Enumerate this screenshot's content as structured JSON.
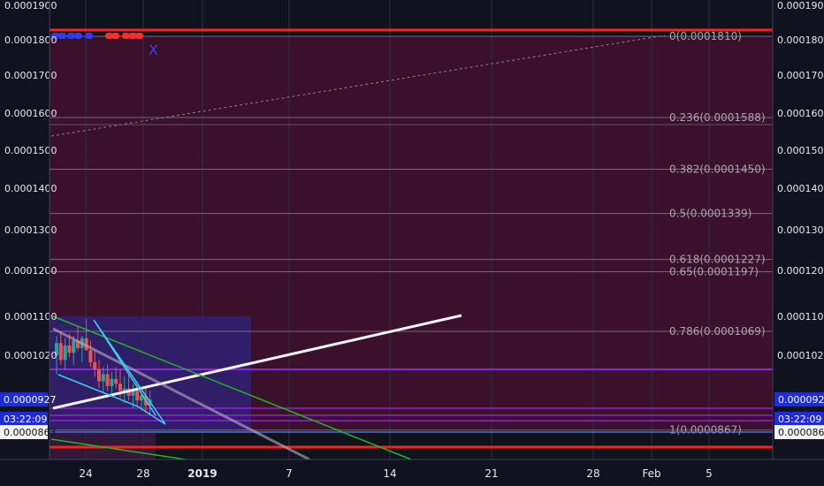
{
  "chart_data": {
    "type": "candlestick",
    "price_axis_labels": [
      "0.0001900",
      "0.0001800",
      "0.0001700",
      "0.0001600",
      "0.0001500",
      "0.0001400",
      "0.0001300",
      "0.0001200",
      "0.0001100",
      "0.0001020"
    ],
    "ylim": [
      8.4e-05,
      0.00019
    ],
    "time_axis_labels": [
      "24",
      "28",
      "2019",
      "7",
      "14",
      "21",
      "28",
      "Feb",
      "5"
    ],
    "fib_levels": [
      {
        "ratio": "0",
        "price": 0.000181,
        "label": "0(0.0001810)"
      },
      {
        "ratio": "0.236",
        "price": 0.0001588,
        "label": "0.236(0.0001588)"
      },
      {
        "ratio": "0.382",
        "price": 0.000145,
        "label": "0.382(0.0001450)"
      },
      {
        "ratio": "0.5",
        "price": 0.0001339,
        "label": "0.5(0.0001339)"
      },
      {
        "ratio": "0.618",
        "price": 0.0001227,
        "label": "0.618(0.0001227)"
      },
      {
        "ratio": "0.65",
        "price": 0.0001197,
        "label": "0.65(0.0001197)"
      },
      {
        "ratio": "0.786",
        "price": 0.0001069,
        "label": "0.786(0.0001069)"
      },
      {
        "ratio": "1",
        "price": 8.67e-05,
        "label": "1(0.0000867)"
      }
    ],
    "current_price_tag": "0.0000927",
    "countdown_tag": "03:22:09",
    "crosshair_price_tag": "0.0000863",
    "marker_text": "X",
    "colors": {
      "fib_zone": "#4a1030",
      "resistance": "#ff1f1f",
      "purple_level": "#a020f0",
      "trend_white": "#f5f5f5",
      "trend_green": "#1fb81f",
      "trend_cyan": "#3ad0f0",
      "candle_up": "#26a69a",
      "candle_down": "#ef5350",
      "tag_blue": "#1e2bd8"
    },
    "candles": [
      {
        "o": 0.000102,
        "h": 0.000106,
        "l": 9.8e-05,
        "c": 0.0001045
      },
      {
        "o": 0.0001045,
        "h": 0.000107,
        "l": 0.0001,
        "c": 0.000101
      },
      {
        "o": 0.000101,
        "h": 0.0001055,
        "l": 9.9e-05,
        "c": 0.000104
      },
      {
        "o": 0.000104,
        "h": 0.0001065,
        "l": 0.0001015,
        "c": 0.0001025
      },
      {
        "o": 0.0001025,
        "h": 0.000106,
        "l": 0.0001,
        "c": 0.000105
      },
      {
        "o": 0.000105,
        "h": 0.000108,
        "l": 0.000103,
        "c": 0.0001035
      },
      {
        "o": 0.0001035,
        "h": 0.000106,
        "l": 0.0001005,
        "c": 0.0001055
      },
      {
        "o": 0.0001055,
        "h": 0.0001095,
        "l": 0.000104,
        "c": 0.000103
      },
      {
        "o": 0.000103,
        "h": 0.000105,
        "l": 9.95e-05,
        "c": 0.0001005
      },
      {
        "o": 0.0001005,
        "h": 0.000103,
        "l": 9.75e-05,
        "c": 9.9e-05
      },
      {
        "o": 9.9e-05,
        "h": 0.000101,
        "l": 9.5e-05,
        "c": 9.65e-05
      },
      {
        "o": 9.65e-05,
        "h": 9.95e-05,
        "l": 9.4e-05,
        "c": 9.8e-05
      },
      {
        "o": 9.8e-05,
        "h": 0.0001,
        "l": 9.45e-05,
        "c": 9.55e-05
      },
      {
        "o": 9.55e-05,
        "h": 9.85e-05,
        "l": 9.35e-05,
        "c": 9.7e-05
      },
      {
        "o": 9.7e-05,
        "h": 9.95e-05,
        "l": 9.5e-05,
        "c": 9.6e-05
      },
      {
        "o": 9.6e-05,
        "h": 9.9e-05,
        "l": 9.3e-05,
        "c": 9.45e-05
      },
      {
        "o": 9.45e-05,
        "h": 9.75e-05,
        "l": 9.2e-05,
        "c": 9.5e-05
      },
      {
        "o": 9.5e-05,
        "h": 9.8e-05,
        "l": 9.25e-05,
        "c": 9.35e-05
      },
      {
        "o": 9.35e-05,
        "h": 9.6e-05,
        "l": 9.1e-05,
        "c": 9.45e-05
      },
      {
        "o": 9.45e-05,
        "h": 9.65e-05,
        "l": 9.15e-05,
        "c": 9.25e-05
      },
      {
        "o": 9.25e-05,
        "h": 9.5e-05,
        "l": 9.05e-05,
        "c": 9.35e-05
      },
      {
        "o": 9.35e-05,
        "h": 9.55e-05,
        "l": 9e-05,
        "c": 9.15e-05
      },
      {
        "o": 9.15e-05,
        "h": 9.45e-05,
        "l": 8.95e-05,
        "c": 9.27e-05
      }
    ]
  }
}
